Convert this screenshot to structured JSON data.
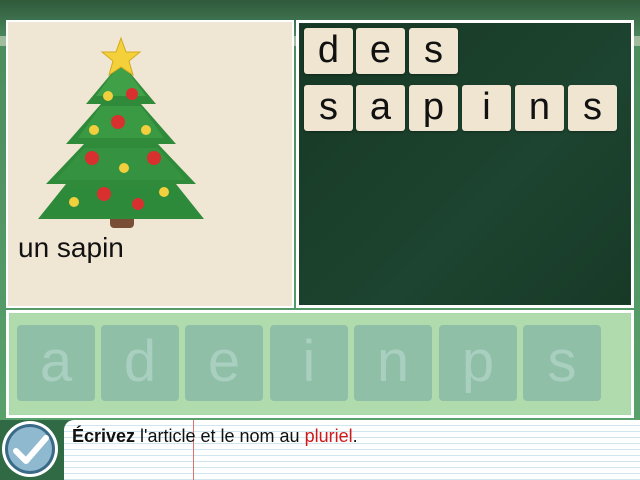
{
  "picture": {
    "caption": "un sapin",
    "icon": "christmas-tree-icon"
  },
  "answer": {
    "line1": [
      "d",
      "e",
      "s"
    ],
    "line2": [
      "s",
      "a",
      "p",
      "i",
      "n",
      "s"
    ]
  },
  "letter_tray": {
    "letters": [
      "a",
      "d",
      "e",
      "i",
      "n",
      "p",
      "s"
    ]
  },
  "instruction": {
    "bold": "Écrivez",
    "text_before": " l'article et le nom au ",
    "highlight": "pluriel",
    "text_after": "."
  },
  "check_button": {
    "icon": "checkmark-icon"
  },
  "colors": {
    "highlight": "#d01818",
    "board": "#1c3d29",
    "tile": "#efe5d0"
  }
}
